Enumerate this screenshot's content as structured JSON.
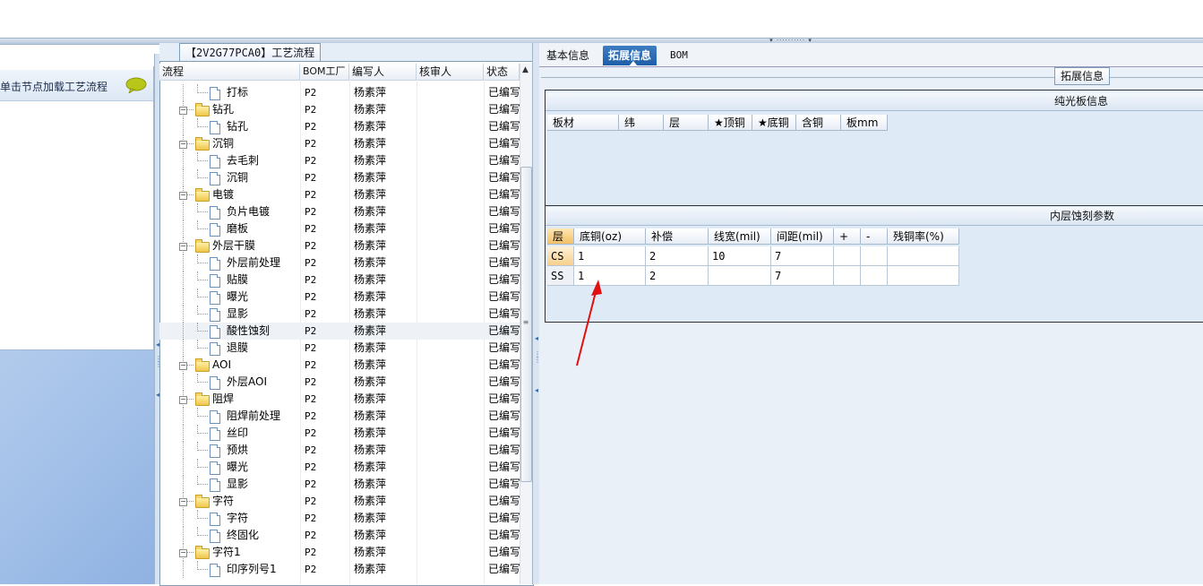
{
  "window": {
    "splitter_glyph": "▾ ·········· ▾"
  },
  "left_panel": {
    "hint": "单击节点加载工艺流程"
  },
  "process_panel": {
    "title": "【2V2G77PCA0】工艺流程",
    "columns": [
      "流程",
      "BOM工厂",
      "编写人",
      "核审人",
      "状态"
    ],
    "scroll_up_glyph": "▲",
    "thumb_grip_glyph": "≡",
    "rows": [
      {
        "name": "打标",
        "type": "item",
        "bom": "P2",
        "writer": "杨素萍",
        "status": "已编写"
      },
      {
        "name": "钻孔",
        "type": "folder",
        "bom": "P2",
        "writer": "杨素萍",
        "status": "已编写"
      },
      {
        "name": "钻孔",
        "type": "item",
        "bom": "P2",
        "writer": "杨素萍",
        "status": "已编写"
      },
      {
        "name": "沉铜",
        "type": "folder",
        "bom": "P2",
        "writer": "杨素萍",
        "status": "已编写"
      },
      {
        "name": "去毛刺",
        "type": "item",
        "bom": "P2",
        "writer": "杨素萍",
        "status": "已编写"
      },
      {
        "name": "沉铜",
        "type": "item",
        "bom": "P2",
        "writer": "杨素萍",
        "status": "已编写"
      },
      {
        "name": "电镀",
        "type": "folder",
        "bom": "P2",
        "writer": "杨素萍",
        "status": "已编写"
      },
      {
        "name": "负片电镀",
        "type": "item",
        "bom": "P2",
        "writer": "杨素萍",
        "status": "已编写"
      },
      {
        "name": "磨板",
        "type": "item",
        "bom": "P2",
        "writer": "杨素萍",
        "status": "已编写"
      },
      {
        "name": "外层干膜",
        "type": "folder",
        "bom": "P2",
        "writer": "杨素萍",
        "status": "已编写"
      },
      {
        "name": "外层前处理",
        "type": "item",
        "bom": "P2",
        "writer": "杨素萍",
        "status": "已编写"
      },
      {
        "name": "贴膜",
        "type": "item",
        "bom": "P2",
        "writer": "杨素萍",
        "status": "已编写"
      },
      {
        "name": "曝光",
        "type": "item",
        "bom": "P2",
        "writer": "杨素萍",
        "status": "已编写"
      },
      {
        "name": "显影",
        "type": "item",
        "bom": "P2",
        "writer": "杨素萍",
        "status": "已编写"
      },
      {
        "name": "酸性蚀刻",
        "type": "item",
        "bom": "P2",
        "writer": "杨素萍",
        "status": "已编写",
        "selected": true
      },
      {
        "name": "退膜",
        "type": "item",
        "bom": "P2",
        "writer": "杨素萍",
        "status": "已编写"
      },
      {
        "name": "AOI",
        "type": "folder",
        "bom": "P2",
        "writer": "杨素萍",
        "status": "已编写"
      },
      {
        "name": "外层AOI",
        "type": "item",
        "bom": "P2",
        "writer": "杨素萍",
        "status": "已编写"
      },
      {
        "name": "阻焊",
        "type": "folder",
        "bom": "P2",
        "writer": "杨素萍",
        "status": "已编写"
      },
      {
        "name": "阻焊前处理",
        "type": "item",
        "bom": "P2",
        "writer": "杨素萍",
        "status": "已编写"
      },
      {
        "name": "丝印",
        "type": "item",
        "bom": "P2",
        "writer": "杨素萍",
        "status": "已编写"
      },
      {
        "name": "预烘",
        "type": "item",
        "bom": "P2",
        "writer": "杨素萍",
        "status": "已编写"
      },
      {
        "name": "曝光",
        "type": "item",
        "bom": "P2",
        "writer": "杨素萍",
        "status": "已编写"
      },
      {
        "name": "显影",
        "type": "item",
        "bom": "P2",
        "writer": "杨素萍",
        "status": "已编写"
      },
      {
        "name": "字符",
        "type": "folder",
        "bom": "P2",
        "writer": "杨素萍",
        "status": "已编写"
      },
      {
        "name": "字符",
        "type": "item",
        "bom": "P2",
        "writer": "杨素萍",
        "status": "已编写"
      },
      {
        "name": "终固化",
        "type": "item",
        "bom": "P2",
        "writer": "杨素萍",
        "status": "已编写"
      },
      {
        "name": "字符1",
        "type": "folder",
        "bom": "P2",
        "writer": "杨素萍",
        "status": "已编写"
      },
      {
        "name": "印序列号1",
        "type": "item",
        "bom": "P2",
        "writer": "杨素萍",
        "status": "已编写"
      }
    ]
  },
  "right_panel": {
    "tabs": [
      "基本信息",
      "拓展信息",
      "BOM"
    ],
    "active_tab": "拓展信息",
    "groupbox_title": "拓展信息",
    "board_section": {
      "title": "纯光板信息",
      "columns": [
        "板材",
        "纬",
        "层",
        "★顶铜",
        "★底铜",
        "含铜",
        "板mm"
      ]
    },
    "etch_section": {
      "title": "内层蚀刻参数",
      "columns": [
        "层",
        "底铜(oz)",
        "补偿",
        "线宽(mil)",
        "间距(mil)",
        "+",
        "-",
        "残铜率(%)"
      ],
      "rows": [
        {
          "layer": "CS",
          "base_copper": "1",
          "compensation": "2",
          "line_width": "10",
          "spacing": "7",
          "plus": "",
          "minus": "",
          "residual": ""
        },
        {
          "layer": "SS",
          "base_copper": "1",
          "compensation": "2",
          "line_width": "",
          "spacing": "7",
          "plus": "",
          "minus": "",
          "residual": ""
        }
      ]
    }
  },
  "colors": {
    "accent_tab": "#2a6ab6",
    "arrow": "#e01010"
  }
}
